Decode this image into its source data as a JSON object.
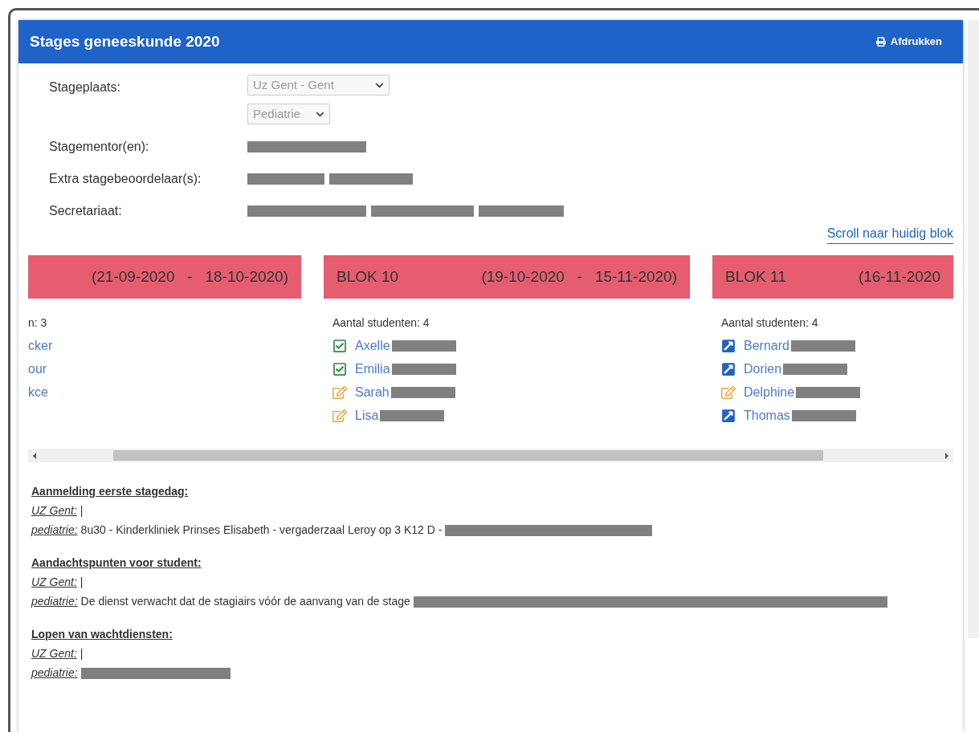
{
  "header": {
    "title": "Stages geneeskunde 2020",
    "print_label": "Afdrukken"
  },
  "fields": [
    {
      "label": "Stageplaats:",
      "kind": "selects",
      "selects": [
        "Uz Gent - Gent",
        "Pediatrie"
      ]
    },
    {
      "label": "Stagementor(en):",
      "kind": "redacted",
      "redacted": true
    },
    {
      "label": "Extra stagebeoordelaar(s):",
      "kind": "redacted",
      "redacted": true
    },
    {
      "label": "Secretariaat:",
      "kind": "redacted",
      "redacted": true
    }
  ],
  "scroll_link": "Scroll naar huidig blok",
  "blocks": [
    {
      "dates": "(21-09-2020   -   18-10-2020)",
      "count": "n: 3",
      "students": [
        {
          "name": "cker",
          "kind": "none",
          "redacted": false
        },
        {
          "name": "our",
          "kind": "none",
          "redacted": false
        },
        {
          "name": "kce",
          "kind": "none",
          "redacted": false
        }
      ]
    },
    {
      "label": "BLOK 10",
      "dates": "(19-10-2020   -   15-11-2020)",
      "count": "Aantal studenten: 4",
      "students": [
        {
          "name": "Axelle",
          "kind": "done",
          "redacted": true
        },
        {
          "name": "Emilia",
          "kind": "done",
          "redacted": true
        },
        {
          "name": "Sarah",
          "kind": "draft",
          "redacted": true
        },
        {
          "name": "Lisa",
          "kind": "draft",
          "redacted": true
        }
      ]
    },
    {
      "label": "BLOK 11",
      "dates": "(16-11-2020",
      "count": "Aantal studenten: 4",
      "students": [
        {
          "name": "Bernard",
          "kind": "open",
          "redacted": true
        },
        {
          "name": "Dorien",
          "kind": "open",
          "redacted": true
        },
        {
          "name": "Delphine",
          "kind": "draft",
          "redacted": true
        },
        {
          "name": "Thomas",
          "kind": "open",
          "redacted": true
        }
      ]
    }
  ],
  "info": [
    {
      "heading": "Aanmelding eerste stagedag:",
      "lines": [
        {
          "label": "UZ Gent:",
          "text": "|",
          "redacted": false
        },
        {
          "label": "pediatrie:",
          "text": "8u30 - Kinderkliniek Prinses Elisabeth - vergaderzaal Leroy op 3 K12 D -",
          "redacted": true
        }
      ]
    },
    {
      "heading": "Aandachtspunten voor student:",
      "lines": [
        {
          "label": "UZ Gent:",
          "text": "|",
          "redacted": false
        },
        {
          "label": "pediatrie:",
          "text": "De dienst verwacht dat de stagiairs vóór de aanvang van de stage",
          "redacted": true
        }
      ]
    },
    {
      "heading": "Lopen van wachtdiensten:",
      "lines": [
        {
          "label": "UZ Gent:",
          "text": "|",
          "redacted": false
        },
        {
          "label": "pediatrie:",
          "redacted": true
        }
      ]
    }
  ]
}
